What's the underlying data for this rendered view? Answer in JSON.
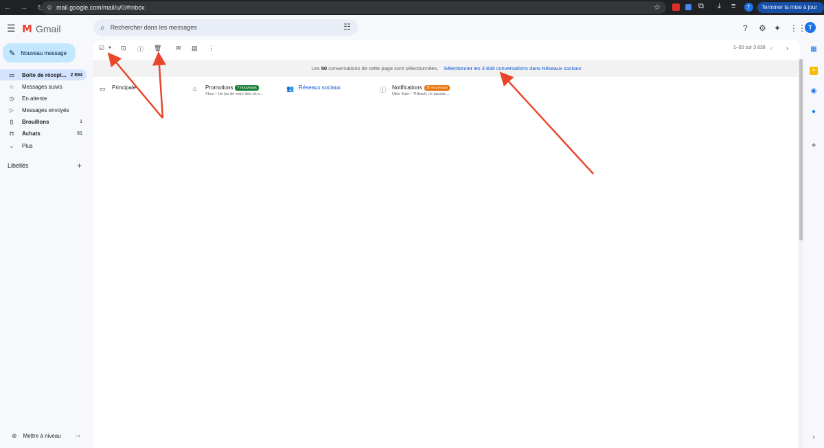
{
  "browser": {
    "back_icon": "back-arrow-icon",
    "url": "mail.google.com/mail/u/0/#inbox",
    "update_label": "Terminer la mise à jour",
    "avatar_letter": "T"
  },
  "header": {
    "app_name": "Gmail",
    "search_placeholder": "Rechercher dans les messages",
    "account_letter": "T"
  },
  "sidebar": {
    "compose_label": "Nouveau message",
    "items": [
      {
        "label": "Boîte de récept...",
        "count": "2 894",
        "icon": "inbox-icon"
      },
      {
        "label": "Messages suivis",
        "count": "",
        "icon": "star-icon"
      },
      {
        "label": "En attente",
        "count": "",
        "icon": "clock-icon"
      },
      {
        "label": "Messages envoyés",
        "count": "",
        "icon": "send-icon"
      },
      {
        "label": "Brouillons",
        "count": "1",
        "icon": "file-icon"
      },
      {
        "label": "Achats",
        "count": "81",
        "icon": "shopping-icon"
      },
      {
        "label": "Plus",
        "count": "",
        "icon": "chevron-down-icon"
      }
    ],
    "labels_title": "Libellés",
    "upgrade_label": "Mettre à niveau"
  },
  "toolbar": {
    "pagination": "1–50 sur 3 838"
  },
  "selection_banner": {
    "prefix": "Les",
    "count": "50",
    "suffix": "conversations de cette page sont sélectionnées.",
    "link": "Sélectionner les 3 838 conversations dans Réseaux sociaux"
  },
  "tabs": [
    {
      "name": "Principale",
      "badge": "",
      "snippet": "",
      "icon": "inbox-icon"
    },
    {
      "name": "Promotions",
      "badge": "7 nouveaux",
      "snippet": "Xbox – Un jeu de votre liste de s...",
      "icon": "tag-icon",
      "badge_color": "#188038"
    },
    {
      "name": "Réseaux sociaux",
      "badge": "",
      "snippet": "",
      "icon": "people-icon"
    },
    {
      "name": "Notifications",
      "badge": "30 nouveaux",
      "snippet": "Uber Eats – Thibault, ne passez ...",
      "icon": "info-icon",
      "badge_color": "#e8710a"
    }
  ],
  "colors": {
    "accent": "#0b57d0",
    "compose_bg": "#c2e7ff",
    "active_nav": "#d3e3fd",
    "annotation_arrow": "#e8462a"
  }
}
